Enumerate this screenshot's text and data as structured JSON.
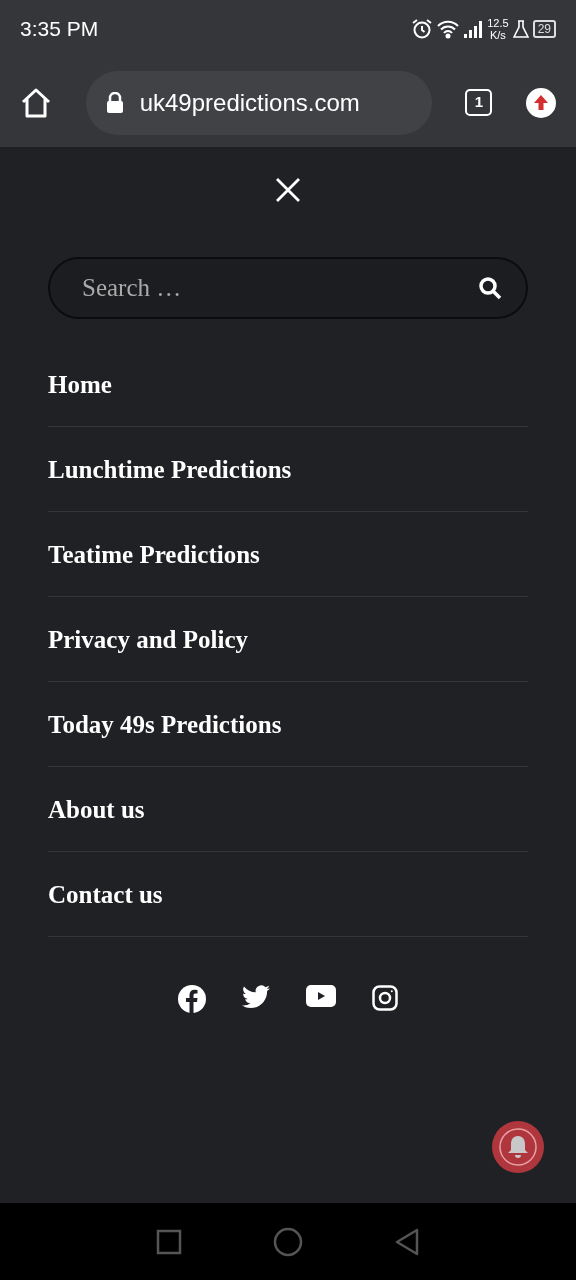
{
  "status_bar": {
    "time": "3:35 PM",
    "speed_value": "12.5",
    "speed_unit": "K/s",
    "battery": "29"
  },
  "browser": {
    "url": "uk49predictions.com",
    "tab_count": "1"
  },
  "search": {
    "placeholder": "Search …"
  },
  "menu": [
    {
      "label": "Home"
    },
    {
      "label": "Lunchtime Predictions"
    },
    {
      "label": "Teatime Predictions"
    },
    {
      "label": "Privacy and Policy"
    },
    {
      "label": "Today 49s Predictions"
    },
    {
      "label": "About us"
    },
    {
      "label": "Contact us"
    }
  ]
}
